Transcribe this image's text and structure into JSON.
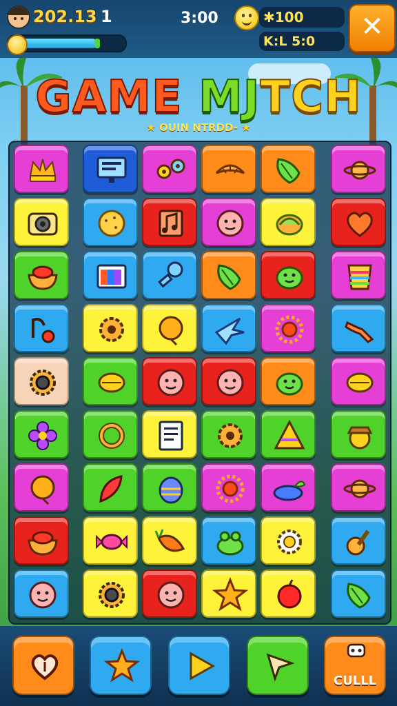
{
  "hud": {
    "score": "202.13",
    "level": "1",
    "timer": "3:00",
    "coins": "100",
    "coins_prefix": "✱",
    "keys": "K:L 5:0",
    "xp_progress": 0.78,
    "close_symbol": "✕"
  },
  "title": {
    "part1": "GAME",
    "part2": "MJ",
    "part3": "TCH"
  },
  "subtitle": {
    "text": "OUIN NTRDD-",
    "star": "★"
  },
  "colors": {
    "magenta": "#e63fd6",
    "blue": "#2fa9f0",
    "orange": "#ff8b1a",
    "yellow": "#fff23a",
    "red": "#e8221c",
    "green": "#4fd32a",
    "peach": "#f7d3b8",
    "deepblue": "#1e5cd8"
  },
  "board": {
    "rows": [
      [
        {
          "c": "magenta",
          "i": "crown-icon"
        },
        {
          "c": "deepblue",
          "i": "monitor-icon"
        },
        {
          "c": "magenta",
          "i": "gears-icon"
        },
        {
          "c": "orange",
          "i": "croissant-icon"
        },
        {
          "c": "orange",
          "i": "leaf-icon"
        },
        {
          "c": "magenta",
          "i": "planet-icon"
        }
      ],
      [
        {
          "c": "yellow",
          "i": "camera-icon"
        },
        {
          "c": "blue",
          "i": "cookie-icon"
        },
        {
          "c": "red",
          "i": "music-icon"
        },
        {
          "c": "magenta",
          "i": "face-icon"
        },
        {
          "c": "yellow",
          "i": "shell-icon"
        },
        {
          "c": "red",
          "i": "heart-icon"
        }
      ],
      [
        {
          "c": "green",
          "i": "bowl-icon"
        },
        {
          "c": "blue",
          "i": "flag-icon"
        },
        {
          "c": "blue",
          "i": "key-icon"
        },
        {
          "c": "orange",
          "i": "leaf-icon"
        },
        {
          "c": "red",
          "i": "blob-icon"
        },
        {
          "c": "magenta",
          "i": "cup-icon"
        }
      ],
      [
        {
          "c": "blue",
          "i": "note-icon"
        },
        {
          "c": "yellow",
          "i": "cog-icon"
        },
        {
          "c": "yellow",
          "i": "ball-icon"
        },
        {
          "c": "blue",
          "i": "bird-icon"
        },
        {
          "c": "magenta",
          "i": "sun-icon"
        },
        {
          "c": "blue",
          "i": "arm-icon"
        }
      ],
      [
        {
          "c": "peach",
          "i": "eye-icon"
        },
        {
          "c": "green",
          "i": "lemon-icon"
        },
        {
          "c": "red",
          "i": "face-icon"
        },
        {
          "c": "red",
          "i": "face-icon"
        },
        {
          "c": "orange",
          "i": "blob-icon"
        },
        {
          "c": "magenta",
          "i": "lemon-icon"
        }
      ],
      [
        {
          "c": "green",
          "i": "flower-icon"
        },
        {
          "c": "green",
          "i": "ring-icon"
        },
        {
          "c": "yellow",
          "i": "doc-icon"
        },
        {
          "c": "green",
          "i": "cog-icon"
        },
        {
          "c": "green",
          "i": "triangle-icon"
        },
        {
          "c": "green",
          "i": "acorn-icon"
        }
      ],
      [
        {
          "c": "magenta",
          "i": "ball-icon"
        },
        {
          "c": "green",
          "i": "feather-icon"
        },
        {
          "c": "green",
          "i": "egg-icon"
        },
        {
          "c": "magenta",
          "i": "sun-icon"
        },
        {
          "c": "magenta",
          "i": "slug-icon"
        },
        {
          "c": "magenta",
          "i": "planet-icon"
        }
      ],
      [
        {
          "c": "red",
          "i": "bowl-icon"
        },
        {
          "c": "yellow",
          "i": "candy-icon"
        },
        {
          "c": "yellow",
          "i": "carrot-icon"
        },
        {
          "c": "blue",
          "i": "frog-icon"
        },
        {
          "c": "yellow",
          "i": "badge-icon"
        },
        {
          "c": "blue",
          "i": "guitar-icon"
        }
      ],
      [
        {
          "c": "blue",
          "i": "face-icon"
        },
        {
          "c": "yellow",
          "i": "eye-icon"
        },
        {
          "c": "red",
          "i": "face-icon"
        },
        {
          "c": "yellow",
          "i": "star-icon"
        },
        {
          "c": "yellow",
          "i": "apple-icon"
        },
        {
          "c": "blue",
          "i": "leaf-icon"
        }
      ]
    ]
  },
  "bottom": {
    "buttons": [
      {
        "name": "heart-button",
        "icon": "heart-outline-icon",
        "color": "orange",
        "label": ""
      },
      {
        "name": "star-button",
        "icon": "star-icon",
        "color": "blue",
        "label": ""
      },
      {
        "name": "play-button",
        "icon": "play-icon",
        "color": "blue",
        "label": ""
      },
      {
        "name": "cursor-button",
        "icon": "cursor-icon",
        "color": "green",
        "label": ""
      },
      {
        "name": "cull-button",
        "icon": "robot-icon",
        "color": "orange",
        "label": "CULLL"
      }
    ]
  }
}
